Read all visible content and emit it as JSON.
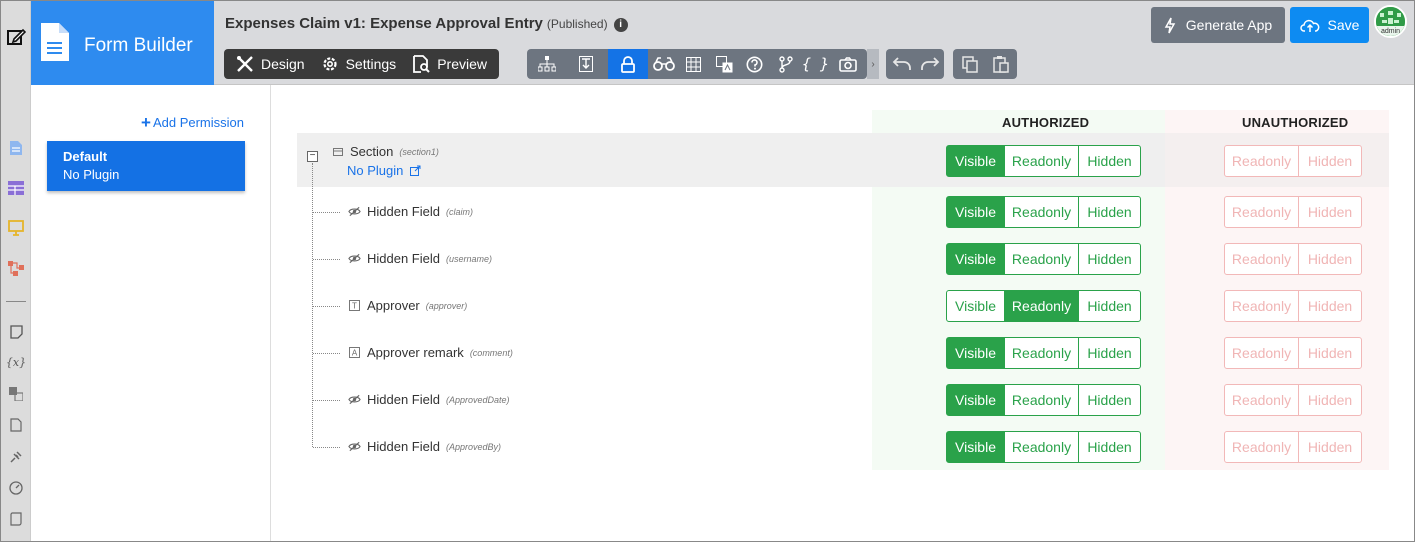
{
  "app": {
    "brand_title": "Form Builder",
    "form_title": "Expenses Claim v1: Expense Approval Entry",
    "form_status": "(Published)",
    "info_glyph": "i"
  },
  "tabs": [
    {
      "label": "Design",
      "icon": "design-tools-icon"
    },
    {
      "label": "Settings",
      "icon": "gear-icon"
    },
    {
      "label": "Preview",
      "icon": "preview-icon"
    }
  ],
  "toolbar_icons": [
    "sitemap-icon",
    "import-export-icon",
    "lock-icon",
    "binoculars-icon",
    "grid-icon",
    "translate-icon",
    "help-icon",
    "branch-icon",
    "braces-icon",
    "camera-icon"
  ],
  "toolbar_active": "lock-icon",
  "braces_glyph": "{ }",
  "buttons": {
    "generate_app": "Generate App",
    "save": "Save"
  },
  "avatar_label": "admin",
  "permissions": {
    "add_label": "Add Permission",
    "add_plus": "+",
    "items": [
      {
        "name": "Default",
        "plugin": "No Plugin"
      }
    ]
  },
  "columns": {
    "authorized": "AUTHORIZED",
    "unauthorized": "UNAUTHORIZED"
  },
  "options": {
    "visible": "Visible",
    "readonly": "Readonly",
    "hidden": "Hidden"
  },
  "section": {
    "label": "Section",
    "id": "(section1)",
    "plugin": "No Plugin",
    "authorized": "visible"
  },
  "fields": [
    {
      "label": "Hidden Field",
      "id": "(claim)",
      "type": "hidden",
      "authorized": "visible"
    },
    {
      "label": "Hidden Field",
      "id": "(username)",
      "type": "hidden",
      "authorized": "visible"
    },
    {
      "label": "Approver",
      "id": "(approver)",
      "type": "text",
      "authorized": "readonly"
    },
    {
      "label": "Approver remark",
      "id": "(comment)",
      "type": "textarea",
      "authorized": "visible"
    },
    {
      "label": "Hidden Field",
      "id": "(ApprovedDate)",
      "type": "hidden",
      "authorized": "visible"
    },
    {
      "label": "Hidden Field",
      "id": "(ApprovedBy)",
      "type": "hidden",
      "authorized": "visible"
    }
  ],
  "colors": {
    "brand": "#2e8bef",
    "active": "#1473e6",
    "green": "#2aa24a",
    "unauth": "#f2b8b8"
  }
}
